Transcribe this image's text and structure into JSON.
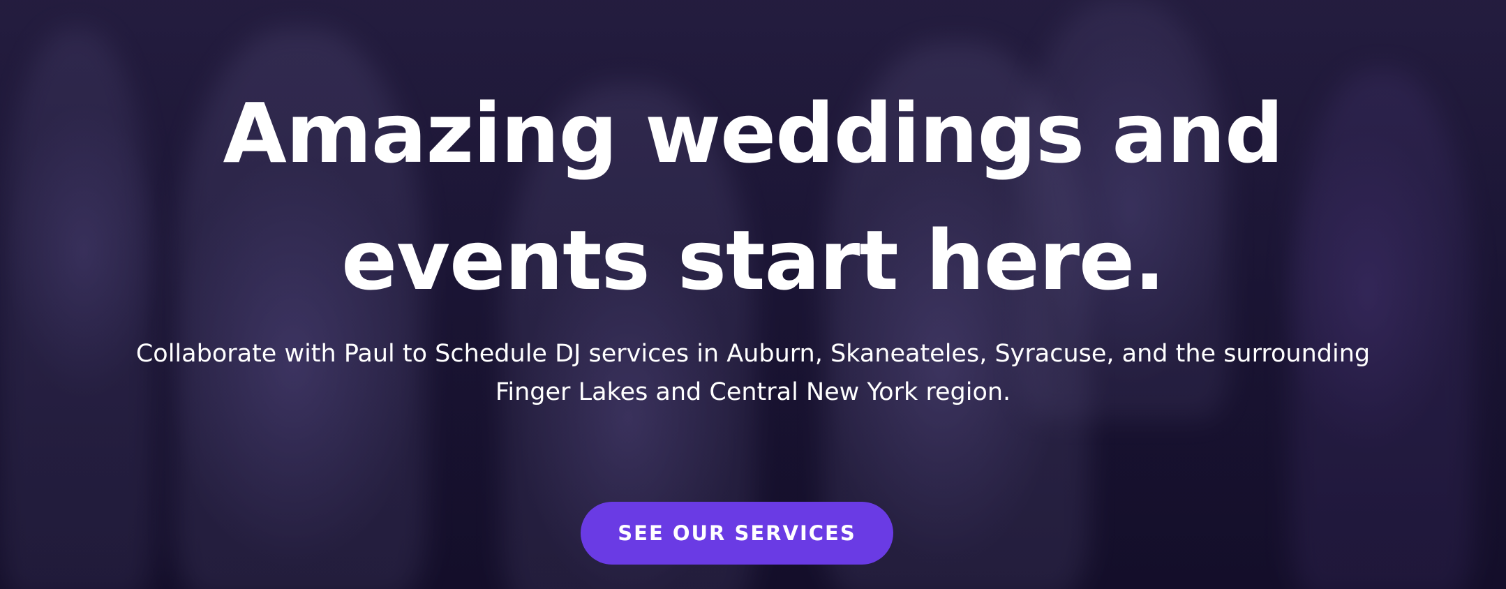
{
  "hero": {
    "headline_line1": "Amazing weddings and",
    "headline_line2": "events start here.",
    "subtitle_line1": "Collaborate with Paul to Schedule DJ services in Auburn, Skaneateles, Syracuse, and the surrounding",
    "subtitle_line2": "Finger Lakes and Central New York region.",
    "cta_label": "SEE OUR SERVICES"
  },
  "colors": {
    "accent": "#6a3be4",
    "text": "#ffffff",
    "background": "#1e1838"
  }
}
